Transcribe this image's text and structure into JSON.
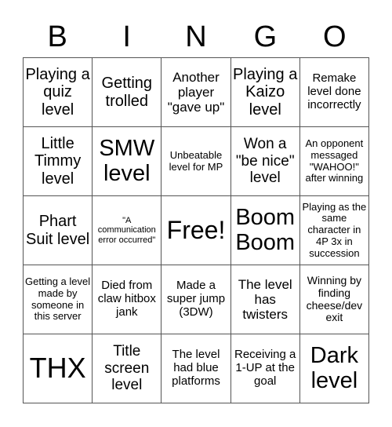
{
  "header": [
    "B",
    "I",
    "N",
    "G",
    "O"
  ],
  "cells": [
    "Playing a quiz level",
    "Getting trolled",
    "Another player \"gave up\"",
    "Playing a Kaizo level",
    "Remake level done incorrectly",
    "Little Timmy level",
    "SMW level",
    "Unbeatable level for MP",
    "Won a \"be nice\" level",
    "An opponent messaged \"WAHOO!\" after winning",
    "Phart Suit level",
    "\"A communication error occurred\"",
    "Free!",
    "Boom Boom",
    "Playing as the same character in 4P 3x in succession",
    "Getting a level made by someone in this server",
    "Died from claw hitbox jank",
    "Made a super jump (3DW)",
    "The level has twisters",
    "Winning by finding cheese/dev exit",
    "THX",
    "Title screen level",
    "The level had blue platforms",
    "Receiving a 1-UP at the goal",
    "Dark level"
  ]
}
